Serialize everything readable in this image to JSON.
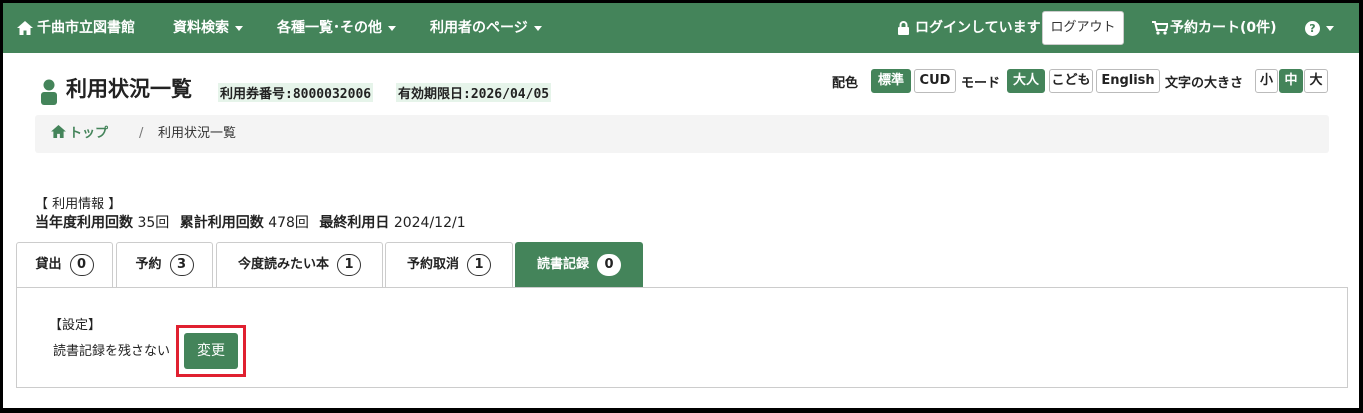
{
  "nav": {
    "library_name": "千曲市立図書館",
    "menu_search": "資料検索",
    "menu_lists": "各種一覧･その他",
    "menu_user": "利用者のページ",
    "login_status": "ログインしています",
    "logout": "ログアウト",
    "cart": "予約カート(0件)",
    "help": "?"
  },
  "header": {
    "title": "利用状況一覧",
    "card_number": "利用券番号:8000032006",
    "expiry": "有効期限日:2026/04/05"
  },
  "prefs": {
    "color_label": "配色",
    "color_standard": "標準",
    "color_cud": "CUD",
    "mode_label": "モード",
    "mode_adult": "大人",
    "mode_child": "こども",
    "mode_english": "English",
    "font_label": "文字の大きさ",
    "font_small": "小",
    "font_medium": "中",
    "font_large": "大"
  },
  "breadcrumb": {
    "home": "トップ",
    "separator": "/",
    "current": "利用状況一覧"
  },
  "usage": {
    "heading": "【 利用情報 】",
    "year_label": "当年度利用回数",
    "year_value": "35回",
    "total_label": "累計利用回数",
    "total_value": "478回",
    "last_label": "最終利用日",
    "last_value": "2024/12/1"
  },
  "tabs": [
    {
      "label": "貸出",
      "count": "0"
    },
    {
      "label": "予約",
      "count": "3"
    },
    {
      "label": "今度読みたい本",
      "count": "1"
    },
    {
      "label": "予約取消",
      "count": "1"
    },
    {
      "label": "読書記録",
      "count": "0"
    }
  ],
  "settings": {
    "heading": "【設定】",
    "status": "読書記録を残さない",
    "change": "変更"
  },
  "colors": {
    "brand_green": "#44845a",
    "highlight_red": "#e02030"
  }
}
